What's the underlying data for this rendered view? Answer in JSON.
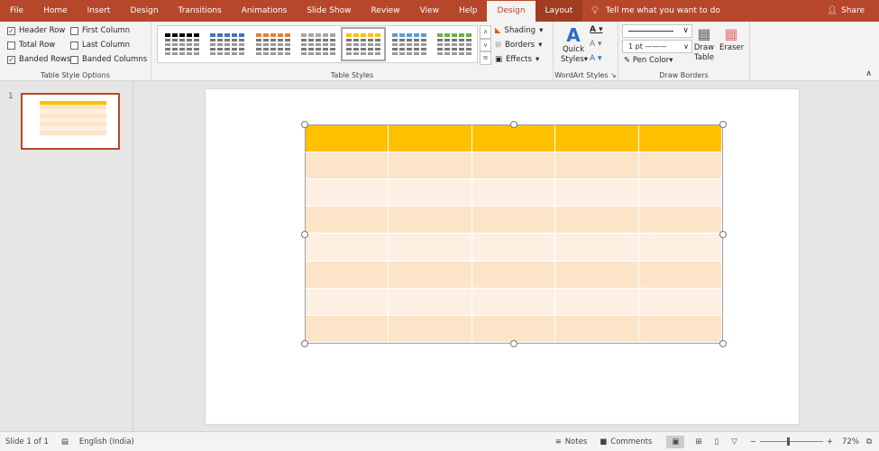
{
  "tabs": [
    "File",
    "Home",
    "Insert",
    "Design",
    "Transitions",
    "Animations",
    "Slide Show",
    "Review",
    "View",
    "Help"
  ],
  "context_tabs": {
    "design": "Design",
    "layout": "Layout"
  },
  "tell_me": "Tell me what you want to do",
  "share": "Share",
  "table_style_options": {
    "label": "Table Style Options",
    "items": [
      {
        "label": "Header Row",
        "checked": true
      },
      {
        "label": "Total Row",
        "checked": false
      },
      {
        "label": "Banded Rows",
        "checked": true
      },
      {
        "label": "First Column",
        "checked": false
      },
      {
        "label": "Last Column",
        "checked": false
      },
      {
        "label": "Banded Columns",
        "checked": false
      }
    ]
  },
  "table_styles": {
    "label": "Table Styles",
    "colors": [
      "#000000",
      "#4472c4",
      "#ed7d31",
      "#a5a5a5",
      "#ffc000",
      "#5b9bd5",
      "#70ad47"
    ],
    "selected": 4,
    "shading": "Shading",
    "borders": "Borders",
    "effects": "Effects"
  },
  "wordart": {
    "label": "WordArt Styles",
    "quick_styles_1": "Quick",
    "quick_styles_2": "Styles"
  },
  "draw_borders": {
    "label": "Draw Borders",
    "pen_weight": "1 pt",
    "pen_color": "Pen Color",
    "draw_table_1": "Draw",
    "draw_table_2": "Table",
    "eraser": "Eraser"
  },
  "slide_panel": {
    "number": "1"
  },
  "table": {
    "header_color": "#ffc000",
    "band1": "#fce4c9",
    "band2": "#fdf0e3",
    "columns": 5,
    "body_rows": 7
  },
  "status": {
    "slide": "Slide 1 of 1",
    "language": "English (India)",
    "notes": "Notes",
    "comments": "Comments",
    "zoom": "72%"
  }
}
